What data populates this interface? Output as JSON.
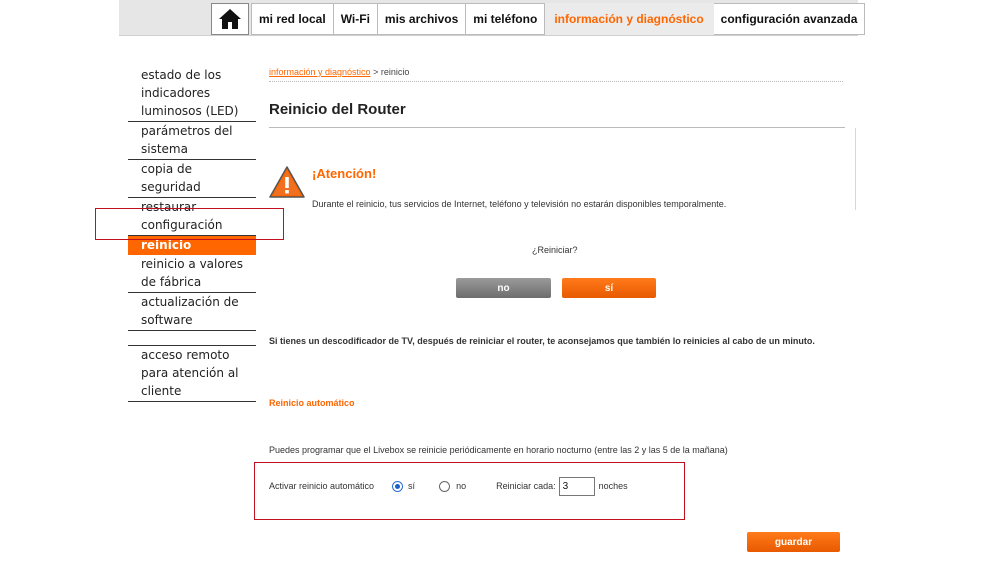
{
  "nav": {
    "home_icon": "home-icon",
    "tabs": [
      {
        "label": "mi red local"
      },
      {
        "label": "Wi-Fi"
      },
      {
        "label": "mis archivos"
      },
      {
        "label": "mi teléfono"
      },
      {
        "label": "información y diagnóstico",
        "active": true
      },
      {
        "label": "configuración avanzada"
      }
    ]
  },
  "sidebar": {
    "items": [
      {
        "label": "estado de los indicadores luminosos (LED)"
      },
      {
        "label": "parámetros del sistema"
      },
      {
        "label": "copia de seguridad"
      },
      {
        "label": "restaurar configuración"
      },
      {
        "label": "reinicio",
        "active": true
      },
      {
        "label": "reinicio a valores de fábrica"
      },
      {
        "label": "actualización de software"
      },
      {
        "label": ""
      },
      {
        "label": "acceso remoto para atención al cliente"
      }
    ]
  },
  "breadcrumb": {
    "parent": "información y diagnóstico",
    "separator": " > ",
    "current": "reinicio"
  },
  "page_title": "Reinicio del Router",
  "warning": {
    "icon": "warning-icon",
    "title": "¡Atención!",
    "text": "Durante el reinicio, tus servicios de Internet, teléfono y televisión no estarán disponibles temporalmente."
  },
  "confirm": {
    "question": "¿Reiniciar?",
    "no_label": "no",
    "yes_label": "sí"
  },
  "tv_note": "Si tienes un descodificador de TV, después de reiniciar el router, te aconsejamos que también lo reinicies al cabo de un minuto.",
  "auto_restart": {
    "section_title": "Reinicio automático",
    "description": "Puedes programar que el Livebox se reinicie periódicamente en horario nocturno (entre las 2 y las 5 de la mañana)",
    "activate_label": "Activar reinicio automático",
    "option_yes": "sí",
    "option_no": "no",
    "selected": "sí",
    "interval_label": "Reiniciar cada:",
    "interval_value": "3",
    "interval_unit": "noches",
    "save_label": "guardar"
  },
  "colors": {
    "accent": "#ff6600",
    "highlight_border": "#c01020",
    "button_grey": "#7a7a7a"
  }
}
